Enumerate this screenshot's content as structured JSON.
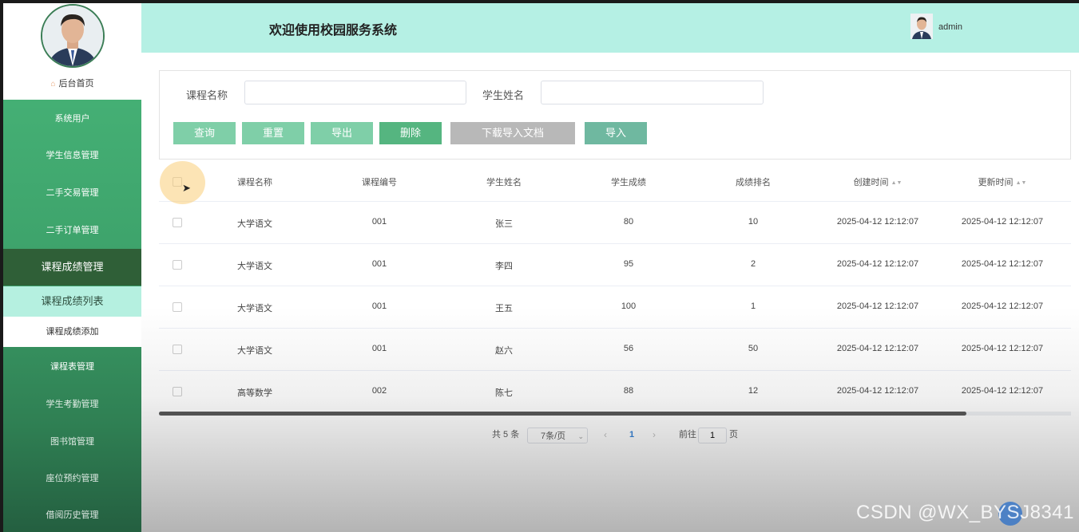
{
  "header": {
    "title": "欢迎使用校园服务系统",
    "username": "admin"
  },
  "sidebar": {
    "home": "后台首页",
    "items": [
      {
        "label": "系统用户"
      },
      {
        "label": "学生信息管理"
      },
      {
        "label": "二手交易管理"
      },
      {
        "label": "二手订单管理"
      },
      {
        "label": "课程成绩管理"
      },
      {
        "label": "课程成绩列表"
      },
      {
        "label": "课程成绩添加"
      },
      {
        "label": "课程表管理"
      },
      {
        "label": "学生考勤管理"
      },
      {
        "label": "图书馆管理"
      },
      {
        "label": "座位预约管理"
      },
      {
        "label": "借阅历史管理"
      }
    ]
  },
  "search": {
    "course_label": "课程名称",
    "course_value": "",
    "student_label": "学生姓名",
    "student_value": "",
    "buttons": {
      "query": "查询",
      "reset": "重置",
      "export": "导出",
      "delete": "删除",
      "download_template": "下载导入文档",
      "import": "导入"
    }
  },
  "table": {
    "columns": [
      "课程名称",
      "课程编号",
      "学生姓名",
      "学生成绩",
      "成绩排名",
      "创建时间",
      "更新时间"
    ],
    "rows": [
      {
        "course": "大学语文",
        "code": "001",
        "student": "张三",
        "score": "80",
        "rank": "10",
        "created": "2025-04-12 12:12:07",
        "updated": "2025-04-12 12:12:07"
      },
      {
        "course": "大学语文",
        "code": "001",
        "student": "李四",
        "score": "95",
        "rank": "2",
        "created": "2025-04-12 12:12:07",
        "updated": "2025-04-12 12:12:07"
      },
      {
        "course": "大学语文",
        "code": "001",
        "student": "王五",
        "score": "100",
        "rank": "1",
        "created": "2025-04-12 12:12:07",
        "updated": "2025-04-12 12:12:07"
      },
      {
        "course": "大学语文",
        "code": "001",
        "student": "赵六",
        "score": "56",
        "rank": "50",
        "created": "2025-04-12 12:12:07",
        "updated": "2025-04-12 12:12:07"
      },
      {
        "course": "高等数学",
        "code": "002",
        "student": "陈七",
        "score": "88",
        "rank": "12",
        "created": "2025-04-12 12:12:07",
        "updated": "2025-04-12 12:12:07"
      }
    ]
  },
  "pagination": {
    "total": "共 5 条",
    "page_size": "7条/页",
    "current_page": "1",
    "goto_prefix": "前往",
    "goto_value": "1",
    "goto_suffix": "页"
  },
  "colors": {
    "header_bg": "#b5f0e4",
    "sidebar_green": "#49b77a",
    "active_parent": "#2f5f37",
    "button_green": "#7fcfa8",
    "delete_green": "#55b580",
    "gray_button": "#b8b8b8",
    "import_button": "#6fb8a0"
  },
  "watermark": "CSDN @WX_BYSJ8341"
}
